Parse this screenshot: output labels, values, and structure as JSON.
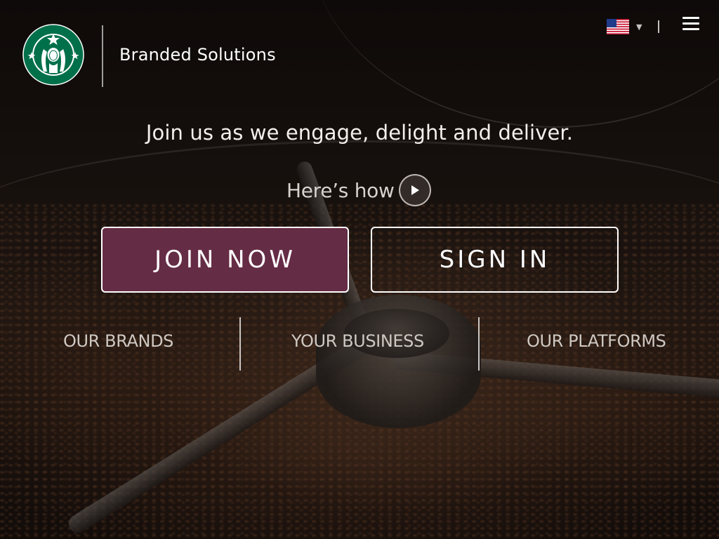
{
  "header": {
    "brand_title": "Branded Solutions",
    "logo_name": "Starbucks siren logo",
    "locale_flag": "us-flag-icon",
    "menu_icon": "hamburger-menu-icon"
  },
  "hero": {
    "tagline": "Join us as we engage, delight and deliver.",
    "video_link_label": "Here’s how",
    "join_button_label": "JOIN NOW",
    "sign_in_button_label": "SIGN IN"
  },
  "nav": {
    "items": [
      {
        "label": "OUR BRANDS"
      },
      {
        "label": "YOUR BUSINESS"
      },
      {
        "label": "OUR PLATFORMS"
      }
    ]
  },
  "colors": {
    "join_button_bg": "#652c45",
    "starbucks_green": "#00704a",
    "text_light": "#ffffff"
  }
}
